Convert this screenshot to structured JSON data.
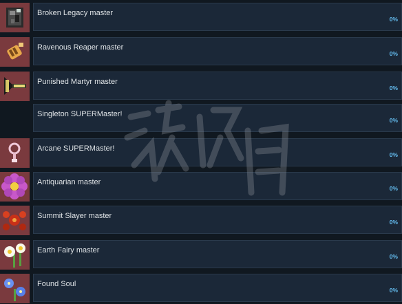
{
  "achievements": [
    {
      "name": "Broken Legacy master",
      "percent": "0%",
      "icon": "broken-legacy-icon",
      "color": "#7a3a3e"
    },
    {
      "name": "Ravenous Reaper master",
      "percent": "0%",
      "icon": "ravenous-reaper-icon",
      "color": "#7a3a3e"
    },
    {
      "name": "Punished Martyr master",
      "percent": "0%",
      "icon": "punished-martyr-icon",
      "color": "#7a3a3e"
    },
    {
      "name": "Singleton SUPERMaster!",
      "percent": "0%",
      "icon": "none",
      "color": "transparent"
    },
    {
      "name": "Arcane SUPERMaster!",
      "percent": "0%",
      "icon": "arcane-ring-icon",
      "color": "#7a3a3e"
    },
    {
      "name": "Antiquarian master",
      "percent": "0%",
      "icon": "flower-icon",
      "color": "#7a3a3e"
    },
    {
      "name": "Summit Slayer master",
      "percent": "0%",
      "icon": "summit-slayer-icon",
      "color": "#7a3a3e"
    },
    {
      "name": "Earth Fairy master",
      "percent": "0%",
      "icon": "earth-fairy-icon",
      "color": "#7a3a3e"
    },
    {
      "name": "Found Soul",
      "percent": "0%",
      "icon": "found-soul-icon",
      "color": "#7a3a3e"
    }
  ],
  "colors": {
    "background": "#101820",
    "card": "#1b2838",
    "percent": "#66c0f4",
    "icon_bg": "#7a3a3e"
  }
}
